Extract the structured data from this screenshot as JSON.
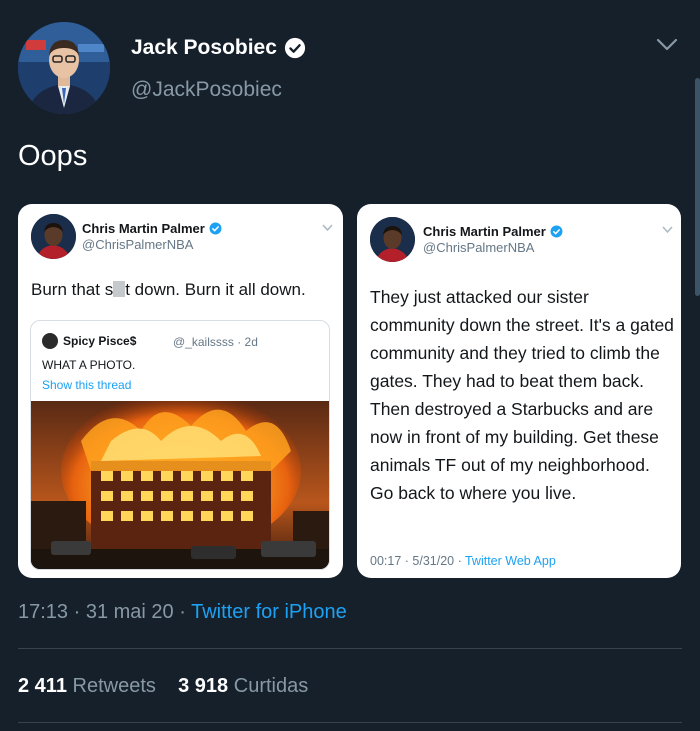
{
  "tweet": {
    "display_name": "Jack Posobiec",
    "handle": "@JackPosobiec",
    "text": "Oops",
    "time": "17:13",
    "date": "31 mai 20",
    "source": "Twitter for iPhone",
    "retweets_count": "2 411",
    "retweets_label": "Retweets",
    "likes_count": "3 918",
    "likes_label": "Curtidas"
  },
  "left_card": {
    "display_name": "Chris Martin Palmer",
    "handle": "@ChrisPalmerNBA",
    "text_before": "Burn that s",
    "text_after": "t down. Burn it all down.",
    "quote": {
      "name": "Spicy Pisce$",
      "handle_date": "@_kailssss · 2d",
      "text": "WHAT A PHOTO.",
      "link": "Show this thread"
    }
  },
  "right_card": {
    "display_name": "Chris Martin Palmer",
    "handle": "@ChrisPalmerNBA",
    "text": "They just attacked our sister community down the street. It's a gated community and they tried to climb the gates. They had to beat them back. Then destroyed a Starbucks and are now in front of my building. Get these animals TF out of my neighborhood. Go back to where you live.",
    "meta": "00:17 · 5/31/20 · ",
    "source": "Twitter Web App"
  },
  "colors": {
    "background": "#15202b",
    "accent": "#1da1f2",
    "secondary_text": "#8899a6"
  },
  "icons": [
    "verified-badge-icon",
    "chevron-down-icon"
  ]
}
